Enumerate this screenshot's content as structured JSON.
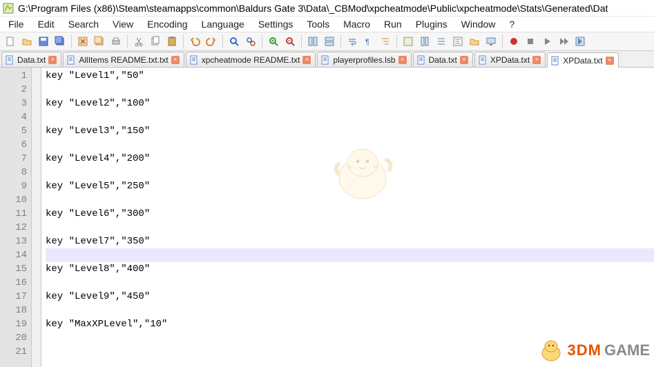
{
  "window": {
    "title": "G:\\Program Files (x86)\\Steam\\steamapps\\common\\Baldurs Gate 3\\Data\\_CBMod\\xpcheatmode\\Public\\xpcheatmode\\Stats\\Generated\\Dat"
  },
  "menu": {
    "items": [
      "File",
      "Edit",
      "Search",
      "View",
      "Encoding",
      "Language",
      "Settings",
      "Tools",
      "Macro",
      "Run",
      "Plugins",
      "Window",
      "?"
    ]
  },
  "tabs": [
    {
      "label": "Data.txt",
      "active": false
    },
    {
      "label": "AllItems README.txt.txt",
      "active": false
    },
    {
      "label": "xpcheatmode README.txt",
      "active": false
    },
    {
      "label": "playerprofiles.lsb",
      "active": false
    },
    {
      "label": "Data.txt",
      "active": false
    },
    {
      "label": "XPData.txt",
      "active": false
    },
    {
      "label": "XPData.txt",
      "active": true
    }
  ],
  "editor": {
    "current_line": 14,
    "lines": [
      "key \"Level1\",\"50\"",
      "",
      "key \"Level2\",\"100\"",
      "",
      "key \"Level3\",\"150\"",
      "",
      "key \"Level4\",\"200\"",
      "",
      "key \"Level5\",\"250\"",
      "",
      "key \"Level6\",\"300\"",
      "",
      "key \"Level7\",\"350\"",
      "",
      "key \"Level8\",\"400\"",
      "",
      "key \"Level9\",\"450\"",
      "",
      "key \"MaxXPLevel\",\"10\"",
      "",
      ""
    ]
  },
  "watermark": {
    "brand1": "3DM",
    "brand2": "GAME"
  }
}
